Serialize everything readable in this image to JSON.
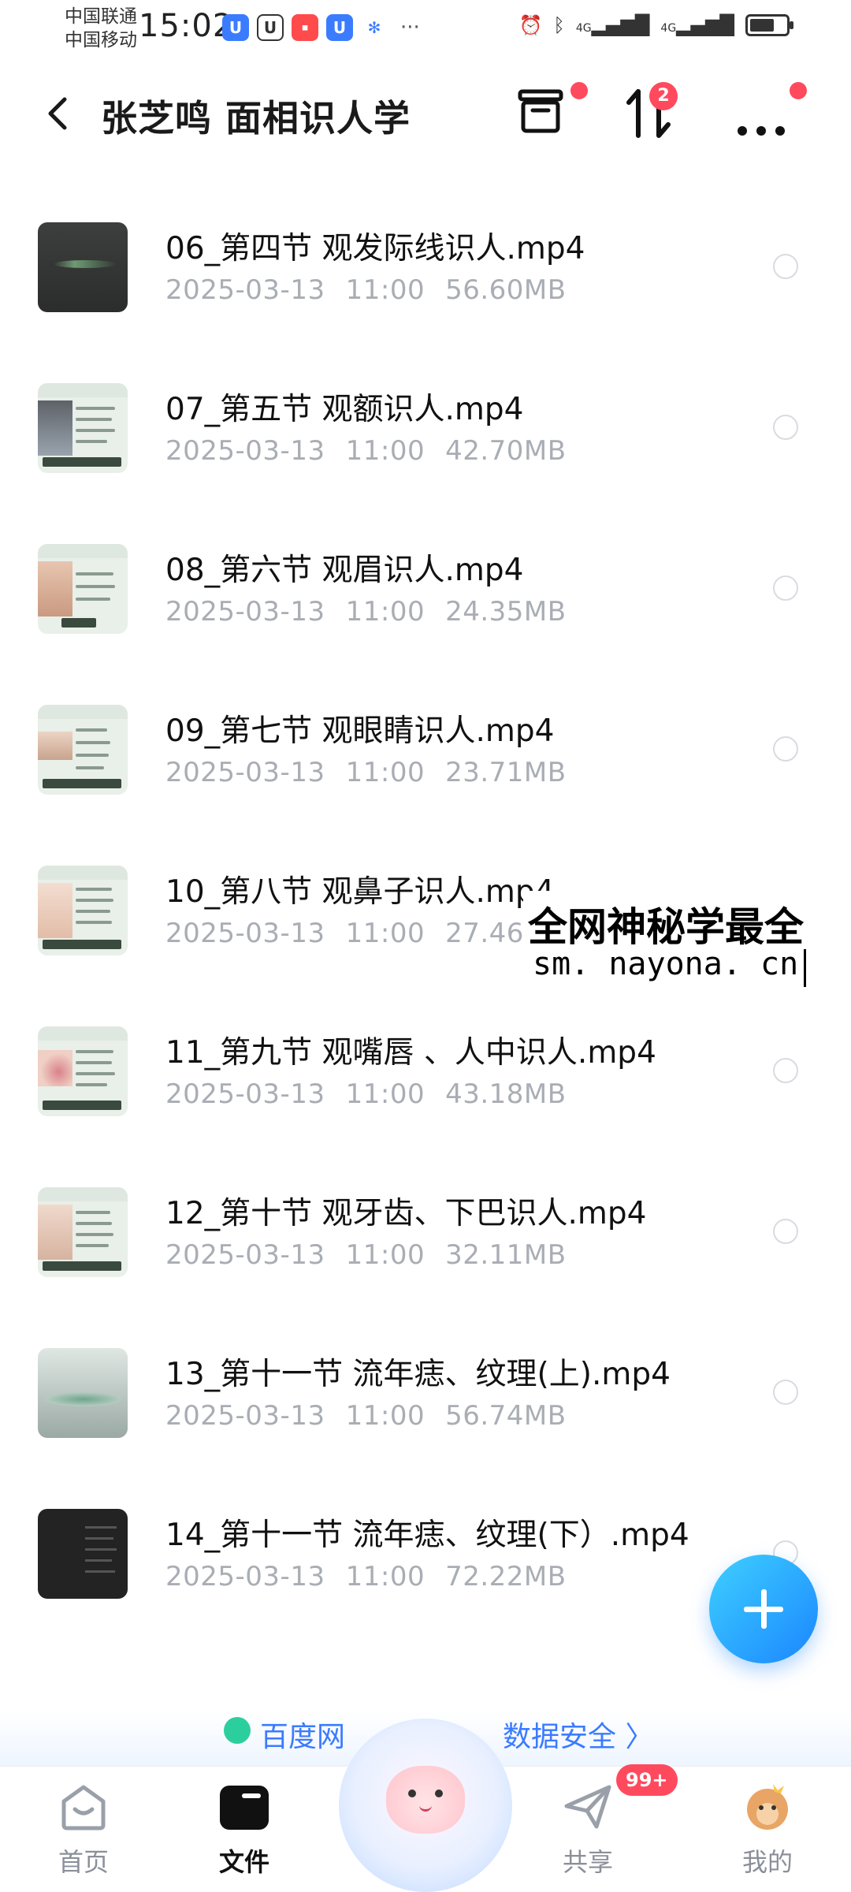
{
  "status_bar": {
    "carrier_1": "中国联通",
    "carrier_2": "中国移动",
    "time": "15:02",
    "more": "···",
    "net_1": "4G",
    "net_2": "4G"
  },
  "header": {
    "title": "张芝鸣 面相识人学",
    "transfer_badge": "2"
  },
  "files": [
    {
      "name": "06_第四节 观发际线识人.mp4",
      "date": "2025-03-13",
      "time": "11:00",
      "size": "56.60MB"
    },
    {
      "name": "07_第五节 观额识人.mp4",
      "date": "2025-03-13",
      "time": "11:00",
      "size": "42.70MB"
    },
    {
      "name": "08_第六节 观眉识人.mp4",
      "date": "2025-03-13",
      "time": "11:00",
      "size": "24.35MB"
    },
    {
      "name": "09_第七节 观眼睛识人.mp4",
      "date": "2025-03-13",
      "time": "11:00",
      "size": "23.71MB"
    },
    {
      "name": "10_第八节 观鼻子识人.mp4",
      "date": "2025-03-13",
      "time": "11:00",
      "size": "27.46MB"
    },
    {
      "name": "11_第九节 观嘴唇 、人中识人.mp4",
      "date": "2025-03-13",
      "time": "11:00",
      "size": "43.18MB"
    },
    {
      "name": "12_第十节 观牙齿、下巴识人.mp4",
      "date": "2025-03-13",
      "time": "11:00",
      "size": "32.11MB"
    },
    {
      "name": "13_第十一节 流年痣、纹理(上).mp4",
      "date": "2025-03-13",
      "time": "11:00",
      "size": "56.74MB"
    },
    {
      "name": "14_第十一节 流年痣、纹理(下）.mp4",
      "date": "2025-03-13",
      "time": "11:00",
      "size": "72.22MB"
    }
  ],
  "watermark": {
    "line1": "全网神秘学最全",
    "line2": "sm. nayona. cn"
  },
  "promo": {
    "text_left": "百度网",
    "text_right": "数据安全 〉"
  },
  "nav": {
    "home": "首页",
    "files": "文件",
    "share": "共享",
    "share_badge": "99+",
    "mine": "我的"
  },
  "colors": {
    "accent": "#1b86ff",
    "badge": "#ff4a5e",
    "meta_text": "#a9adb4"
  }
}
